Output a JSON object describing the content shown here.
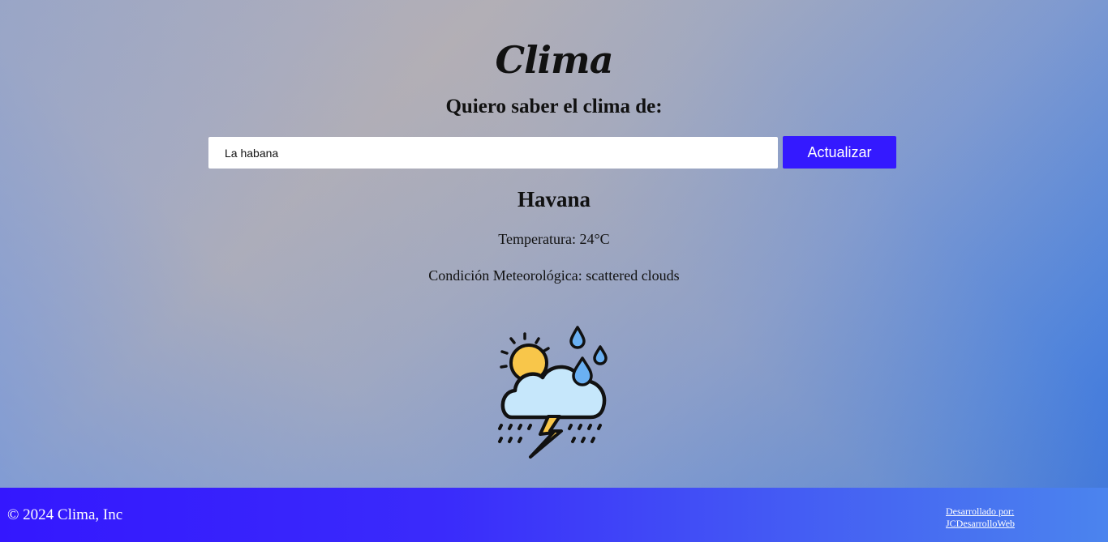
{
  "header": {
    "title": "Clima",
    "subtitle": "Quiero saber el clima de:"
  },
  "search": {
    "value": "La habana",
    "button_label": "Actualizar"
  },
  "weather": {
    "city": "Havana",
    "temperature_text": "Temperatura: 24°C",
    "condition_text": "Condición Meteorológica: scattered clouds",
    "icon": "sun-cloud-rain-thunderstorm-icon"
  },
  "footer": {
    "copyright": "© 2024 Clima, Inc",
    "credit_line1": "Desarrollado por:",
    "credit_line2": "JCDesarrolloWeb"
  },
  "colors": {
    "button": "#3419ff",
    "footer_start": "#3417fe",
    "footer_end": "#4b84ee"
  }
}
